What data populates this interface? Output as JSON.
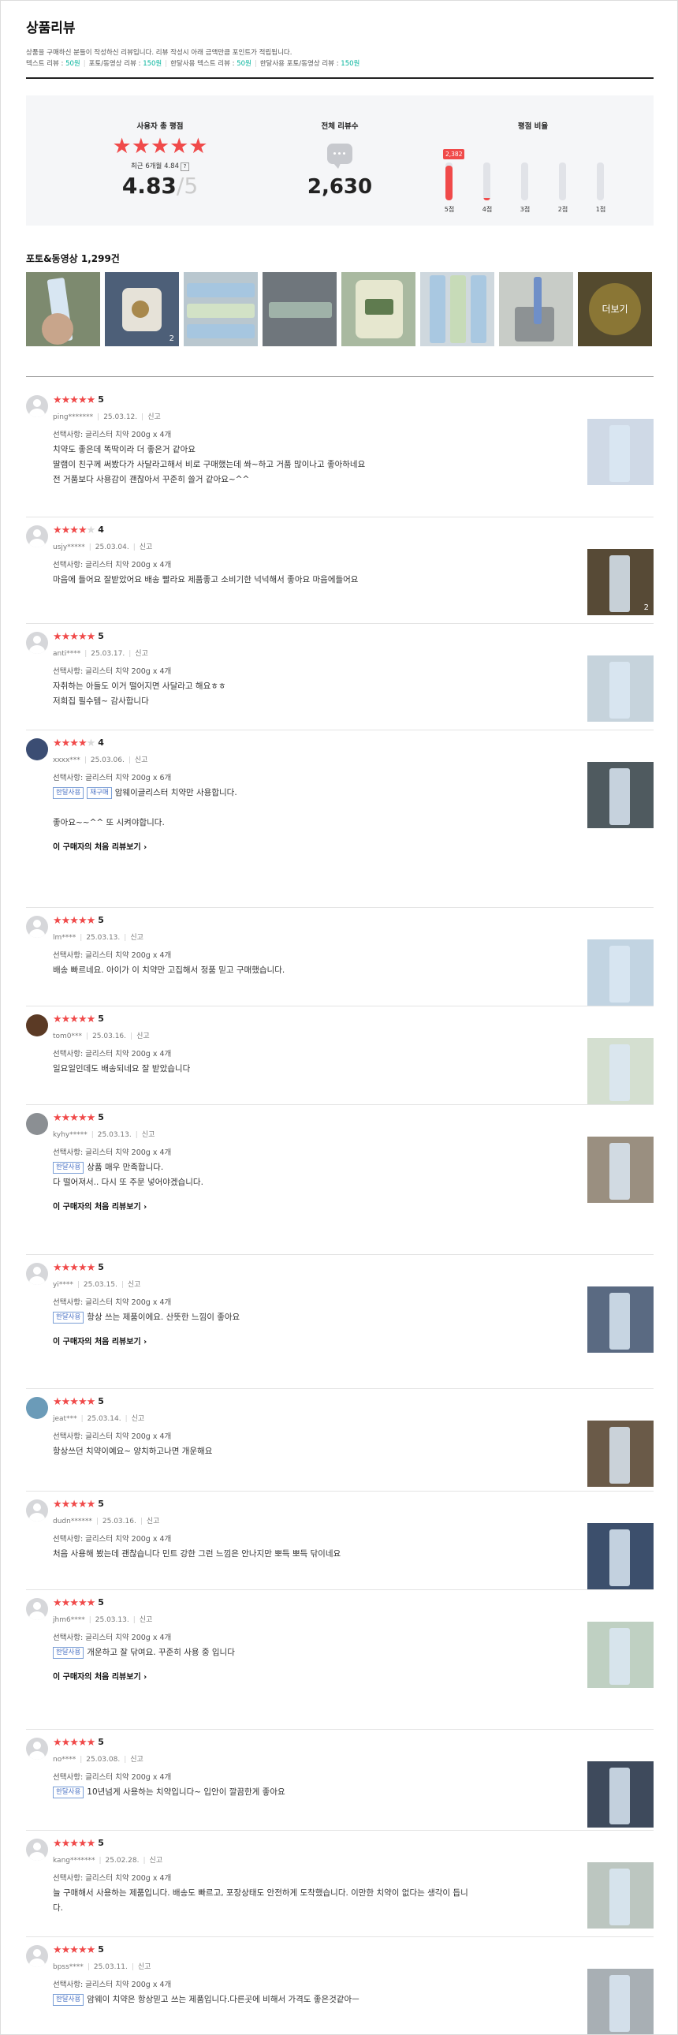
{
  "header": {
    "title": "상품리뷰",
    "notice": "상품을 구매하신 분들이 작성하신 리뷰입니다. 리뷰 작성시 아래 금액만큼 포인트가 적립됩니다.",
    "points": [
      {
        "label": "텍스트 리뷰",
        "value": "50원"
      },
      {
        "label": "포토/동영상 리뷰",
        "value": "150원"
      },
      {
        "label": "한달사용 텍스트 리뷰",
        "value": "50원"
      },
      {
        "label": "한달사용 포토/동영상 리뷰",
        "value": "150원"
      }
    ]
  },
  "summary": {
    "rating_title": "사용자 총 평점",
    "rating_stars": "★★★★★",
    "recent_text": "최근 6개월 4.84",
    "recent_help": "?",
    "rating": "4.83",
    "rating_max": "/5",
    "total_title": "전체 리뷰수",
    "total": "2,630",
    "ratio_title": "평점 비율",
    "top_count": "2,382",
    "dist": [
      {
        "label": "5점",
        "fraction": 0.91
      },
      {
        "label": "4점",
        "fraction": 0.06
      },
      {
        "label": "3점",
        "fraction": 0.02
      },
      {
        "label": "2점",
        "fraction": 0.005
      },
      {
        "label": "1점",
        "fraction": 0.005
      }
    ]
  },
  "photos": {
    "title": "포토&동영상 1,299건",
    "badge": "2",
    "more": "더보기"
  },
  "reviews": [
    {
      "score": "5",
      "id": "ping*******",
      "date": "25.03.12.",
      "report": "신고",
      "option": "선택사항: 글리스터 치약 200g x 4개",
      "tag1": "",
      "tag2": "",
      "lines": [
        "치약도 좋은데 똑딱이라 더 좋은거 같아요",
        "딸램이 친구께 써봤다가 사달라고해서 비로 구매했는데 쏴~하고 거품 많이나고 좋아하네요",
        "전 거품보다 사용감이 괜찮아서 꾸준히 쓸거 같아요~^^"
      ],
      "link": "",
      "img_badge": ""
    },
    {
      "score": "4",
      "id": "usjy*****",
      "date": "25.03.04.",
      "report": "신고",
      "option": "선택사항: 글리스터 치약 200g x 4개",
      "tag1": "",
      "tag2": "",
      "lines": [
        "마음에 들어요 잘받았어요 배송 빨라요 제품좋고 소비기한 넉넉해서 좋아요 마음에들어요"
      ],
      "link": "",
      "img_badge": "2"
    },
    {
      "score": "5",
      "id": "anti****",
      "date": "25.03.17.",
      "report": "신고",
      "option": "선택사항: 글리스터 치약 200g x 4개",
      "tag1": "",
      "tag2": "",
      "lines": [
        "자취하는 아들도 이거 떨어지면 사달라고 해요ㅎㅎ",
        "저희집 필수템~ 감사합니다"
      ],
      "link": "",
      "img_badge": ""
    },
    {
      "score": "4",
      "id": "xxxx***",
      "date": "25.03.06.",
      "report": "신고",
      "option": "선택사항: 글리스터 치약 200g x 6개",
      "tag1": "한달사용",
      "tag2": "재구매",
      "lines": [
        "암웨이글리스터 치약만 사용합니다.",
        "",
        "좋아요~~^^ 또 시켜야합니다."
      ],
      "link": "이 구매자의 처음 리뷰보기 ›",
      "img_badge": ""
    },
    {
      "score": "5",
      "id": "lm****",
      "date": "25.03.13.",
      "report": "신고",
      "option": "선택사항: 글리스터 치약 200g x 4개",
      "tag1": "",
      "tag2": "",
      "lines": [
        "배송 빠르네요. 아이가 이 치약만 고집해서 정품 믿고 구매했습니다."
      ],
      "link": "",
      "img_badge": ""
    },
    {
      "score": "5",
      "id": "tom0***",
      "date": "25.03.16.",
      "report": "신고",
      "option": "선택사항: 글리스터 치약 200g x 4개",
      "tag1": "",
      "tag2": "",
      "lines": [
        "일요일인데도 배송되네요 잘 받았습니다"
      ],
      "link": "",
      "img_badge": ""
    },
    {
      "score": "5",
      "id": "kyhy*****",
      "date": "25.03.13.",
      "report": "신고",
      "option": "선택사항: 글리스터 치약 200g x 4개",
      "tag1": "한달사용",
      "tag2": "",
      "lines": [
        "상품 매우 만족합니다.",
        "다 떨어져서.. 다시 또 주문 넣어야겠습니다."
      ],
      "link": "이 구매자의 처음 리뷰보기 ›",
      "img_badge": ""
    },
    {
      "score": "5",
      "id": "yi****",
      "date": "25.03.15.",
      "report": "신고",
      "option": "선택사항: 글리스터 치약 200g x 4개",
      "tag1": "한달사용",
      "tag2": "",
      "lines": [
        "항상 쓰는 제품이에요. 산뜻한 느낌이 좋아요"
      ],
      "link": "이 구매자의 처음 리뷰보기 ›",
      "img_badge": ""
    },
    {
      "score": "5",
      "id": "jeat***",
      "date": "25.03.14.",
      "report": "신고",
      "option": "선택사항: 글리스터 치약 200g x 4개",
      "tag1": "",
      "tag2": "",
      "lines": [
        "항상쓰던 치약이예요~ 양치하고나면 개운해요"
      ],
      "link": "",
      "img_badge": ""
    },
    {
      "score": "5",
      "id": "dudn******",
      "date": "25.03.16.",
      "report": "신고",
      "option": "선택사항: 글리스터 치약 200g x 4개",
      "tag1": "",
      "tag2": "",
      "lines": [
        "처음 사용해 봤는데 괜찮습니다 민트 강한 그런 느낌은 안나지만 뽀득 뽀득 닦이네요"
      ],
      "link": "",
      "img_badge": ""
    },
    {
      "score": "5",
      "id": "jhm6****",
      "date": "25.03.13.",
      "report": "신고",
      "option": "선택사항: 글리스터 치약 200g x 4개",
      "tag1": "한달사용",
      "tag2": "",
      "lines": [
        "개운하고 잘 닦여요. 꾸준히 사용 중 입니다"
      ],
      "link": "이 구매자의 처음 리뷰보기 ›",
      "img_badge": ""
    },
    {
      "score": "5",
      "id": "no****",
      "date": "25.03.08.",
      "report": "신고",
      "option": "선택사항: 글리스터 치약 200g x 4개",
      "tag1": "한달사용",
      "tag2": "",
      "lines": [
        "10년넘게 사용하는 치약입니다~ 입안이 깔끔한게 좋아요"
      ],
      "link": "",
      "img_badge": ""
    },
    {
      "score": "5",
      "id": "kang*******",
      "date": "25.02.28.",
      "report": "신고",
      "option": "선택사항: 글리스터 치약 200g x 4개",
      "tag1": "",
      "tag2": "",
      "lines": [
        "늘 구매해서 사용하는 제품입니다. 배송도 빠르고, 포장상태도 안전하게 도착했습니다. 이만한 치약이 없다는 생각이 듭니",
        "다."
      ],
      "link": "",
      "img_badge": ""
    },
    {
      "score": "5",
      "id": "bpss****",
      "date": "25.03.11.",
      "report": "신고",
      "option": "선택사항: 글리스터 치약 200g x 4개",
      "tag1": "한달사용",
      "tag2": "",
      "lines": [
        "암웨이 치약은 항상믿고 쓰는 제품입니다.다른곳에 비해서 가격도 좋은것같아ㅡ"
      ],
      "link": "",
      "img_badge": ""
    }
  ]
}
